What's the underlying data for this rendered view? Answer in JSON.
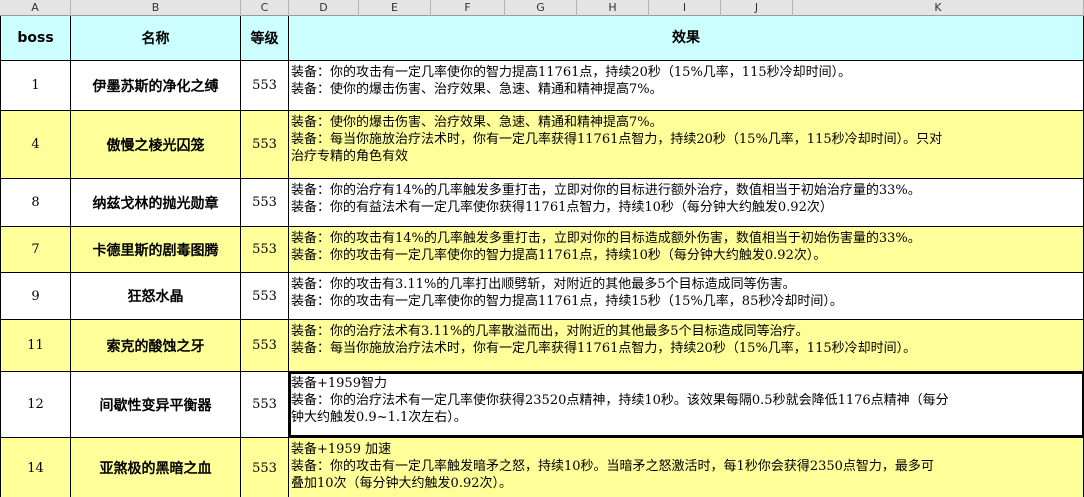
{
  "columns": [
    "A",
    "B",
    "C",
    "D",
    "E",
    "F",
    "G",
    "H",
    "I",
    "J",
    "K"
  ],
  "headers": {
    "boss": "boss",
    "name": "名称",
    "level": "等级",
    "effect": "效果"
  },
  "rows": [
    {
      "boss": "1",
      "name": "伊墨苏斯的净化之缚",
      "level": "553",
      "effect": [
        "装备：你的攻击有一定几率使你的智力提高11761点，持续20秒（15%几率，115秒冷却时间）。",
        "装备：使你的爆击伤害、治疗效果、急速、精通和精神提高7%。"
      ]
    },
    {
      "boss": "4",
      "name": "傲慢之棱光囚笼",
      "level": "553",
      "effect": [
        "装备：使你的爆击伤害、治疗效果、急速、精通和精神提高7%。",
        "装备：每当你施放治疗法术时，你有一定几率获得11761点智力，持续20秒（15%几率，115秒冷却时间）。只对",
        "治疗专精的角色有效"
      ]
    },
    {
      "boss": "8",
      "name": "纳兹戈林的抛光勋章",
      "level": "553",
      "effect": [
        "装备：你的治疗有14%的几率触发多重打击，立即对你的目标进行额外治疗，数值相当于初始治疗量的33%。",
        "装备：你的有益法术有一定几率使你获得11761点智力，持续10秒（每分钟大约触发0.92次）"
      ]
    },
    {
      "boss": "7",
      "name": "卡德里斯的剧毒图腾",
      "level": "553",
      "effect": [
        "装备：你的攻击有14%的几率触发多重打击，立即对你的目标造成额外伤害，数值相当于初始伤害量的33%。",
        "装备：你的攻击有一定几率使你的智力提高11761点，持续10秒（每分钟大约触发0.92次）。"
      ]
    },
    {
      "boss": "9",
      "name": "狂怒水晶",
      "level": "553",
      "effect": [
        "装备：你的攻击有3.11%的几率打出顺劈斩，对附近的其他最多5个目标造成同等伤害。",
        "装备：你的攻击有一定几率使你的智力提高11761点，持续15秒（15%几率，85秒冷却时间）。"
      ]
    },
    {
      "boss": "11",
      "name": "索克的酸蚀之牙",
      "level": "553",
      "effect": [
        "装备：你的治疗法术有3.11%的几率散溢而出，对附近的其他最多5个目标造成同等治疗。",
        "装备：每当你施放治疗法术时，你有一定几率获得11761点智力，持续20秒（15%几率，115秒冷却时间）。"
      ]
    },
    {
      "boss": "12",
      "name": "间歇性变异平衡器",
      "level": "553",
      "effect": [
        "装备+1959智力",
        "装备：你的治疗法术有一定几率使你获得23520点精神，持续10秒。该效果每隔0.5秒就会降低1176点精神（每分",
        "钟大约触发0.9~1.1次左右）。"
      ]
    },
    {
      "boss": "14",
      "name": "亚煞极的黑暗之血",
      "level": "553",
      "effect": [
        "装备+1959 加速",
        "装备：你的攻击有一定几率触发暗矛之怒，持续10秒。当暗矛之怒激活时，每1秒你会获得2350点智力，最多可",
        "叠加10次（每分钟大约触发0.92次）。"
      ]
    }
  ]
}
